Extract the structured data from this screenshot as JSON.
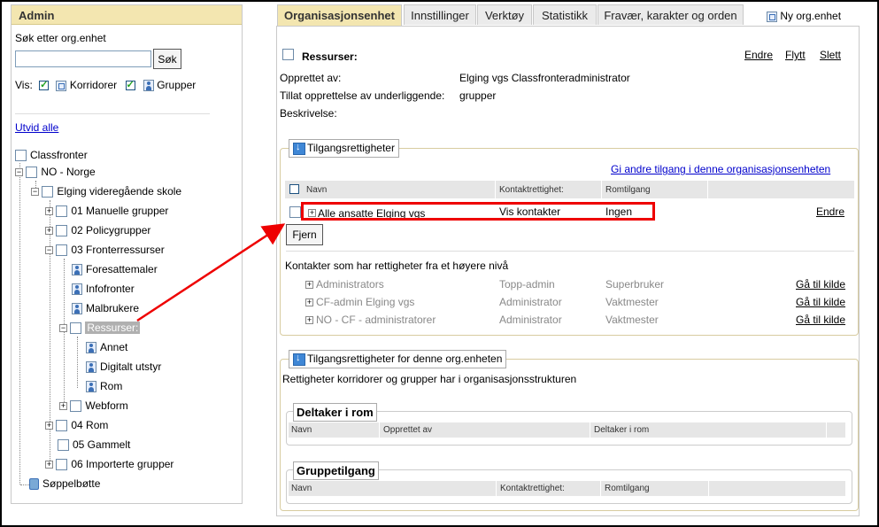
{
  "left": {
    "title": "Admin",
    "search_label": "Søk etter org.enhet",
    "search_value": "",
    "search_button": "Søk",
    "show_label": "Vis:",
    "filter_corridors": "Korridorer",
    "filter_groups": "Grupper",
    "expand_all": "Utvid alle",
    "tree": {
      "classfronter": "Classfronter",
      "no_norge": "NO - Norge",
      "elging": "Elging videregående skole",
      "manuelle": "01 Manuelle grupper",
      "policy": "02 Policygrupper",
      "fronter": "03 Fronterressurser",
      "foresatte": "Foresattemaler",
      "infofronter": "Infofronter",
      "malbrukere": "Malbrukere",
      "ressurser": "Ressurser:",
      "annet": "Annet",
      "digitalt": "Digitalt utstyr",
      "rom": "Rom",
      "webform": "Webform",
      "rom04": "04 Rom",
      "gammelt": "05 Gammelt",
      "importerte": "06 Importerte grupper",
      "trash": "Søppelbøtte"
    }
  },
  "tabs": [
    "Organisasjonsenhet",
    "Innstillinger",
    "Verktøy",
    "Statistikk",
    "Fravær, karakter og orden"
  ],
  "new_org": "Ny org.enhet",
  "unit": {
    "name": "Ressurser:",
    "actions": [
      "Endre",
      "Flytt",
      "Slett"
    ],
    "created_by_label": "Opprettet av:",
    "created_by_value": "Elging vgs Classfronteradministrator",
    "allow_label": "Tillat opprettelse av underliggende:",
    "allow_value": "grupper",
    "description_label": "Beskrivelse:"
  },
  "access": {
    "legend": "Tilgangsrettigheter",
    "give_access_link": "Gi andre tilgang i denne organisasjonsenheten",
    "headers": [
      "Navn",
      "Kontaktrettighet:",
      "Romtilgang"
    ],
    "row": {
      "name": "Alle ansatte Elging vgs",
      "contact": "Vis kontakter",
      "room": "Ingen",
      "action": "Endre"
    },
    "remove_button": "Fjern",
    "inherited_title": "Kontakter som har rettigheter fra et høyere nivå",
    "inherited": [
      {
        "name": "Administrators",
        "contact": "Topp-admin",
        "room": "Superbruker",
        "action": "Gå til kilde"
      },
      {
        "name": "CF-admin Elging vgs",
        "contact": "Administrator",
        "room": "Vaktmester",
        "action": "Gå til kilde"
      },
      {
        "name": "NO - CF - administratorer",
        "contact": "Administrator",
        "room": "Vaktmester",
        "action": "Gå til kilde"
      }
    ]
  },
  "unit_access": {
    "legend": "Tilgangsrettigheter for denne org.enheten",
    "subtitle": "Rettigheter korridorer og grupper har i organisasjonsstrukturen",
    "participant": {
      "legend": "Deltaker i rom",
      "headers": [
        "Navn",
        "Opprettet av",
        "Deltaker i rom"
      ]
    },
    "group": {
      "legend": "Gruppetilgang",
      "headers": [
        "Navn",
        "Kontaktrettighet:",
        "Romtilgang"
      ]
    }
  },
  "colors": {
    "highlight": "#e00000",
    "header_bg": "#f3e6b0",
    "link": "#0000cc"
  }
}
